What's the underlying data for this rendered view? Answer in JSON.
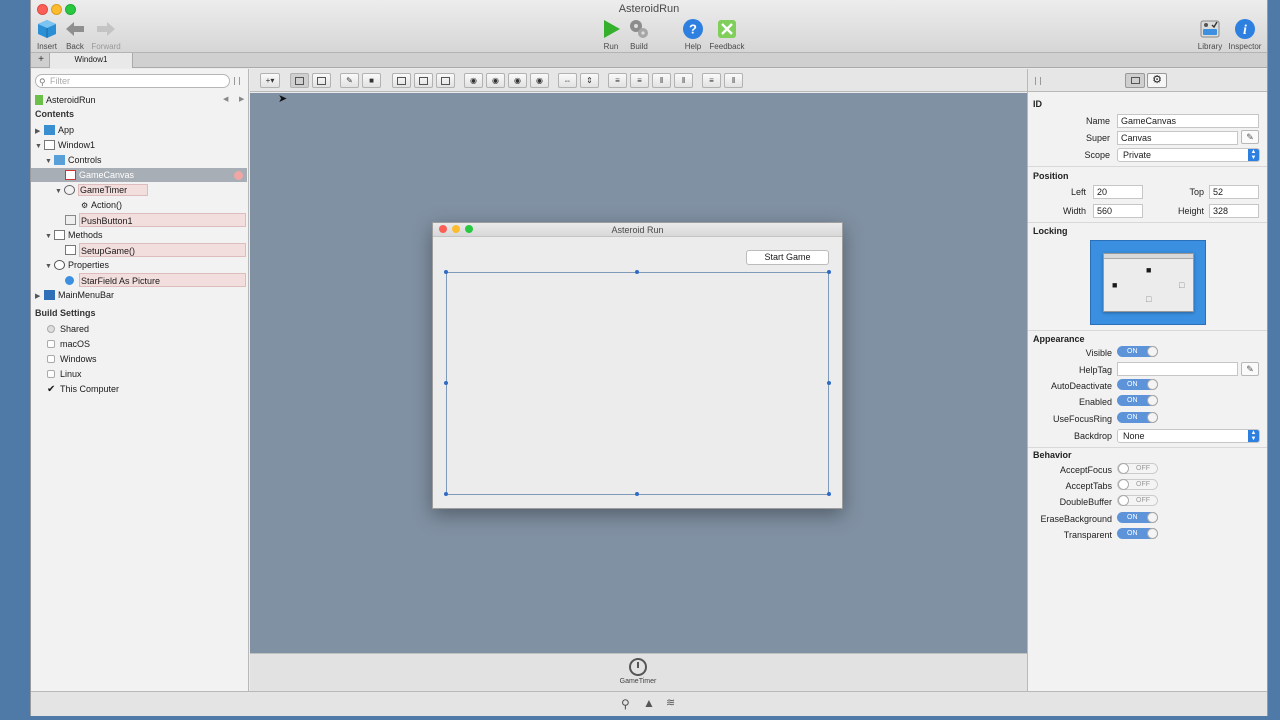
{
  "app": {
    "title": "AsteroidRun"
  },
  "toolbar": {
    "insert": "Insert",
    "back": "Back",
    "forward": "Forward",
    "run": "Run",
    "build": "Build",
    "help": "Help",
    "feedback": "Feedback",
    "library": "Library",
    "inspector": "Inspector"
  },
  "tabs": {
    "plus": "+",
    "window1": "Window1"
  },
  "sidebar": {
    "filter_placeholder": "Filter",
    "project": "AsteroidRun",
    "contents_heading": "Contents",
    "items": {
      "app": "App",
      "window1": "Window1",
      "controls": "Controls",
      "gamecanvas": "GameCanvas",
      "gametimer": "GameTimer",
      "action": "Action()",
      "pushbutton1": "PushButton1",
      "methods": "Methods",
      "setupgame": "SetupGame()",
      "properties": "Properties",
      "starfield": "StarField As Picture",
      "mainmenubar": "MainMenuBar"
    },
    "build_heading": "Build Settings",
    "build": {
      "shared": "Shared",
      "macos": "macOS",
      "windows": "Windows",
      "linux": "Linux",
      "this_computer": "This Computer"
    }
  },
  "designer": {
    "window_title": "Asteroid Run",
    "start_button": "Start Game",
    "tray_item": "GameTimer"
  },
  "inspector": {
    "id_heading": "ID",
    "name_label": "Name",
    "name_value": "GameCanvas",
    "super_label": "Super",
    "super_value": "Canvas",
    "scope_label": "Scope",
    "scope_value": "Private",
    "position_heading": "Position",
    "left_label": "Left",
    "left_value": "20",
    "top_label": "Top",
    "top_value": "52",
    "width_label": "Width",
    "width_value": "560",
    "height_label": "Height",
    "height_value": "328",
    "locking_heading": "Locking",
    "appearance_heading": "Appearance",
    "visible_label": "Visible",
    "helptag_label": "HelpTag",
    "autodeactivate_label": "AutoDeactivate",
    "enabled_label": "Enabled",
    "usefocusring_label": "UseFocusRing",
    "backdrop_label": "Backdrop",
    "backdrop_value": "None",
    "behavior_heading": "Behavior",
    "acceptfocus_label": "AcceptFocus",
    "accepttabs_label": "AcceptTabs",
    "doublebuffer_label": "DoubleBuffer",
    "erasebackground_label": "EraseBackground",
    "transparent_label": "Transparent",
    "on": "ON",
    "off": "OFF"
  },
  "colors": {
    "accent": "#2d7fe0",
    "canvas_bg": "#8091a3",
    "selection": "#f3dede",
    "desktop": "#4f7aa8"
  }
}
